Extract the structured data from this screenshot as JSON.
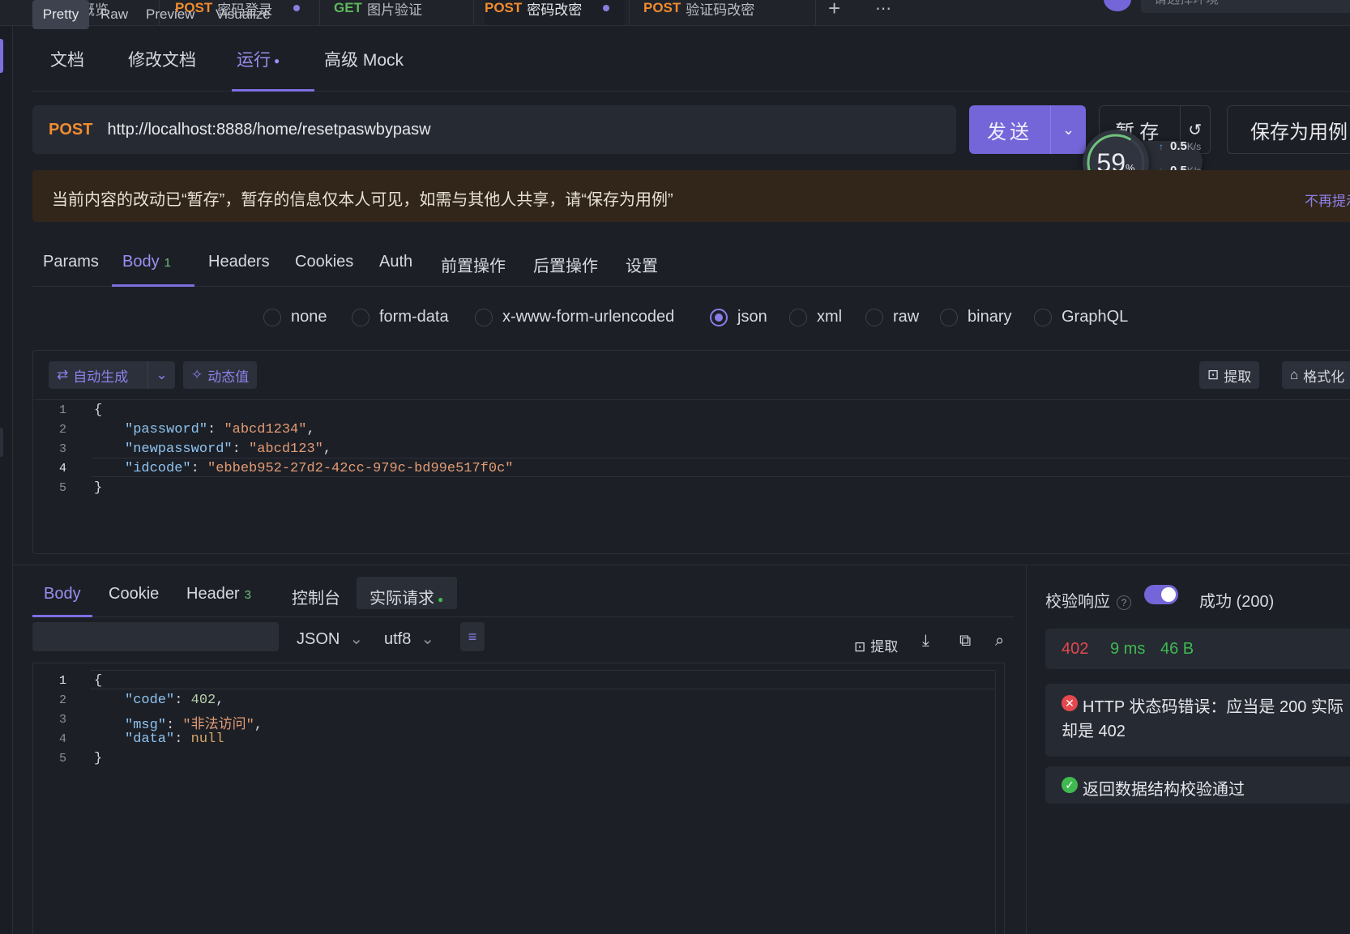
{
  "top_tabs": [
    {
      "method": "",
      "label": "项目概览"
    },
    {
      "method": "POST",
      "label": "密码登录"
    },
    {
      "method": "GET",
      "label": "图片验证"
    },
    {
      "method": "POST",
      "label": "密码改密"
    },
    {
      "method": "POST",
      "label": "验证码改密"
    }
  ],
  "top_right": {
    "env_placeholder": "请选择环境"
  },
  "doc_tabs": [
    "文档",
    "修改文档",
    "运行",
    "高级 Mock"
  ],
  "request": {
    "method": "POST",
    "url": "http://localhost:8888/home/resetpaswbypasw",
    "send_label": "发送",
    "save_label": "暂存",
    "save_as_label": "保存为用例"
  },
  "speed": {
    "percent": "59",
    "unit": "%",
    "up": "0.5",
    "down": "0.5",
    "rate_unit": "K/s"
  },
  "banner": {
    "text": "当前内容的改动已“暂存”，暂存的信息仅本人可见，如需与其他人共享，请“保存为用例”",
    "link": "不再提示"
  },
  "sub_tabs": [
    {
      "label": "Params"
    },
    {
      "label": "Body",
      "badge": "1"
    },
    {
      "label": "Headers"
    },
    {
      "label": "Cookies"
    },
    {
      "label": "Auth"
    },
    {
      "label": "前置操作"
    },
    {
      "label": "后置操作"
    },
    {
      "label": "设置"
    }
  ],
  "body_types": [
    "none",
    "form-data",
    "x-www-form-urlencoded",
    "json",
    "xml",
    "raw",
    "binary",
    "GraphQL"
  ],
  "body_selected": "json",
  "body_toolbar": {
    "auto_gen": "自动生成",
    "dynamic": "动态值",
    "extract": "提取",
    "format": "格式化"
  },
  "request_body_lines": [
    {
      "no": "1",
      "text": "{"
    },
    {
      "no": "2",
      "key": "\"password\"",
      "value": "\"abcd1234\"",
      "tail": ","
    },
    {
      "no": "3",
      "key": "\"newpassword\"",
      "value": "\"abcd123\"",
      "tail": ","
    },
    {
      "no": "4",
      "key": "\"idcode\"",
      "value": "\"ebbeb952-27d2-42cc-979c-bd99e517f0c\"",
      "tail": ""
    },
    {
      "no": "5",
      "text": "}"
    }
  ],
  "response_tabs": [
    {
      "label": "Body"
    },
    {
      "label": "Cookie"
    },
    {
      "label": "Header",
      "badge": "3"
    },
    {
      "label": "控制台"
    },
    {
      "label": "实际请求"
    }
  ],
  "view_modes": [
    "Pretty",
    "Raw",
    "Preview",
    "Visualize"
  ],
  "format": "JSON",
  "encoding": "utf8",
  "response_toolbar": {
    "extract": "提取"
  },
  "response_body_lines": [
    {
      "no": "1",
      "text": "{"
    },
    {
      "no": "2",
      "key": "\"code\"",
      "num": "402",
      "tail": ","
    },
    {
      "no": "3",
      "key": "\"msg\"",
      "value": "\"非法访问\"",
      "tail": ","
    },
    {
      "no": "4",
      "key": "\"data\"",
      "kw": "null",
      "tail": ""
    },
    {
      "no": "5",
      "text": "}"
    }
  ],
  "validation": {
    "label": "校验响应",
    "result": "成功 (200)",
    "status": "402",
    "time": "9 ms",
    "size": "46 B",
    "error": "HTTP 状态码错误：应当是 200 实际",
    "error_line2": "却是 402",
    "ok": "返回数据结构校验通过"
  },
  "colors": {
    "accent": "#7466d8",
    "post": "#f08c2f",
    "get": "#5cb85c",
    "error": "#e5484d",
    "success": "#3fb950"
  }
}
